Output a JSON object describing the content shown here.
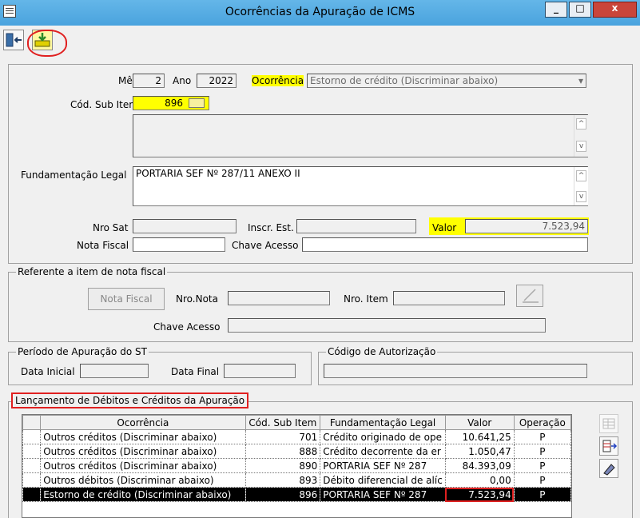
{
  "window": {
    "title": "Ocorrências da Apuração de ICMS",
    "minimize": "_",
    "maximize": "□",
    "close": "x"
  },
  "form": {
    "mes_label": "Mês",
    "mes_value": "2",
    "ano_label": "Ano",
    "ano_value": "2022",
    "ocorrencia_label": "Ocorrência",
    "ocorrencia_value": "Estorno de crédito (Discriminar abaixo)",
    "cod_sub_item_label": "Cód. Sub Item",
    "cod_sub_item_value": "896",
    "descricao_value": "",
    "fundamentacao_label": "Fundamentação Legal",
    "fundamentacao_value": "PORTARIA SEF Nº 287/11 ANEXO II",
    "nro_sat_label": "Nro Sat",
    "inscr_est_label": "Inscr. Est.",
    "valor_label": "Valor",
    "valor_value": "7.523,94",
    "nota_fiscal_label": "Nota Fiscal",
    "chave_acesso_label": "Chave Acesso"
  },
  "referente": {
    "title": "Referente a item de nota fiscal",
    "nota_fiscal_button": "Nota Fiscal",
    "nro_nota_label": "Nro.Nota",
    "nro_item_label": "Nro. Item",
    "chave_acesso_label": "Chave Acesso"
  },
  "periodo": {
    "title": "Período de Apuração do ST",
    "data_inicial_label": "Data Inicial",
    "data_final_label": "Data Final"
  },
  "codigo_autorizacao": {
    "title": "Código de Autorização"
  },
  "lancamento": {
    "title": "Lançamento de Débitos e Créditos da Apuração",
    "columns": [
      "Ocorrência",
      "Cód. Sub Item",
      "Fundamentação Legal",
      "Valor",
      "Operação"
    ],
    "rows": [
      {
        "ocorrencia": "Outros créditos (Discriminar abaixo)",
        "cod": "701",
        "fund": "Crédito originado de ope",
        "valor": "10.641,25",
        "op": "P"
      },
      {
        "ocorrencia": "Outros créditos (Discriminar abaixo)",
        "cod": "888",
        "fund": "Crédito decorrente da er",
        "valor": "1.050,47",
        "op": "P"
      },
      {
        "ocorrencia": "Outros créditos (Discriminar abaixo)",
        "cod": "890",
        "fund": "PORTARIA SEF Nº 287",
        "valor": "84.393,09",
        "op": "P"
      },
      {
        "ocorrencia": "Outros débitos (Discriminar abaixo)",
        "cod": "893",
        "fund": "Débito diferencial de alíc",
        "valor": "0,00",
        "op": "P"
      },
      {
        "ocorrencia": "Estorno de crédito (Discriminar abaixo)",
        "cod": "896",
        "fund": "PORTARIA SEF Nº 287",
        "valor": "7.523,94",
        "op": "P"
      }
    ]
  }
}
